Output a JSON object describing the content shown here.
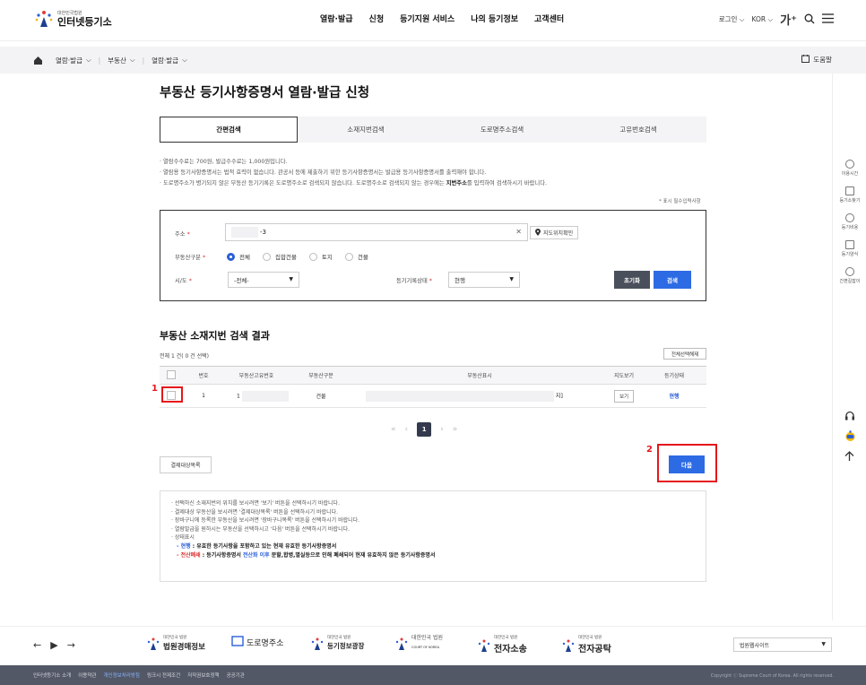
{
  "header": {
    "logo_small": "대한민국법원",
    "logo_big": "인터넷등기소",
    "gnb": [
      "열람·발급",
      "신청",
      "등기지원 서비스",
      "나의 등기정보",
      "고객센터"
    ],
    "login": "로그인",
    "lang": "KOR",
    "font_size_glyph": "가⁺"
  },
  "breadcrumb": {
    "items": [
      "열람·발급",
      "부동산",
      "열람·발급"
    ],
    "help": "도움말"
  },
  "page_title": "부동산 등기사항증명서 열람·발급 신청",
  "tabs": [
    "간편검색",
    "소재지번검색",
    "도로명주소검색",
    "고유번호검색"
  ],
  "notes": {
    "line1": "· 열람수수료는 700원, 발급수수료는 1,000원입니다.",
    "line2": "· 열람용 등기사항증명서는 법적 효력이 없습니다. 관공서 등에 제출하기 위한 등기사항증명서는 발급용 등기사항증명서를 출력해야 합니다.",
    "line3_pre": "· 도로명주소가 병기되지 않은 부동산 등기기록은 도로명주소로 검색되지 않습니다. 도로명주소로 검색되지 않는 경우에는 ",
    "line3_bold": "지번주소",
    "line3_post": "를 입력하여 검색하시기 바랍니다.",
    "required": "* 표시 필수입력사항"
  },
  "form": {
    "address_label": "주소",
    "address_value": "-3",
    "map_btn": "지도위치확인",
    "type_label": "부동산구분",
    "types": [
      "전체",
      "집합건물",
      "토지",
      "건물"
    ],
    "region_label": "시/도",
    "region_value": "-전체-",
    "status_label": "등기기록상태",
    "status_value": "현행",
    "reset": "초기화",
    "search": "검색",
    "req_mark": "*"
  },
  "results": {
    "title": "부동산 소재지번 검색 결과",
    "count": "전체 1 건( 0 건 선택)",
    "clear_btn": "전체선택해제",
    "columns": [
      "번호",
      "부동산고유번호",
      "부동산구분",
      "부동산표시",
      "지도보기",
      "등기상태"
    ],
    "row": {
      "no": "1",
      "id_prefix": "1",
      "type": "건물",
      "address_suffix": "지]",
      "view": "보기",
      "status": "현행"
    }
  },
  "pager": {
    "first": "«",
    "prev": "‹",
    "current": "1",
    "next": "›",
    "last": "»"
  },
  "actions": {
    "pay_list": "결제대상목록",
    "next": "다음"
  },
  "markers": {
    "one": "1",
    "two": "2"
  },
  "guide": {
    "l1": "· 선택하신 소재지번의 위치를 보시려면 '보기' 버튼을 선택하시기 바랍니다.",
    "l2": "· 결제대상 부동산을 보시려면 '결제대상목록' 버튼을 선택하시기 바랍니다.",
    "l3": "· 장바구니에 등록한 부동산을 보시려면 '장바구니목록' 버튼을 선택하시기 바랍니다.",
    "l4": "· 열람발급을 원하시는 부동산을 선택하시고 '다음' 버튼을 선택하시기 바랍니다.",
    "l5": "· 상태표시",
    "l6_tag": "- 현행",
    "l6_text": " : 유효한 등기사항을 포함하고 있는 현재 유효한 등기사항증명서",
    "l7_tag": "- 전산폐쇄",
    "l7_mid": " : 등기사항증명서 ",
    "l7_blue": "전산화 이후",
    "l7_text": " 분할,합병,멸실등으로 인해 폐쇄되어 현재 유효하지 않은 등기사항증명서"
  },
  "quick_menu": [
    "이용시간",
    "등기소찾기",
    "등기비용",
    "등기양식",
    "간편길잡이"
  ],
  "footer": {
    "banners": [
      {
        "small": "대한민국 법원",
        "big": "법원경매정보"
      },
      {
        "small": "",
        "big": "도로명주소"
      },
      {
        "small": "대한민국 법원",
        "big": "등기정보광장"
      },
      {
        "small": "대한민국 법원",
        "big": "COURT OF KOREA"
      },
      {
        "small": "대한민국 법원",
        "big": "전자소송"
      },
      {
        "small": "대한민국 법원",
        "big": "전자공탁"
      }
    ],
    "family_site": "법원웹사이트",
    "links": [
      "인터넷등기소 소개",
      "이용약관",
      "개인정보처리방침",
      "링크시 전제조건",
      "저작권보호정책",
      "공공기관"
    ],
    "copyright": "Copyright ⓒ Supreme Court of Korea. All rights reserved."
  }
}
